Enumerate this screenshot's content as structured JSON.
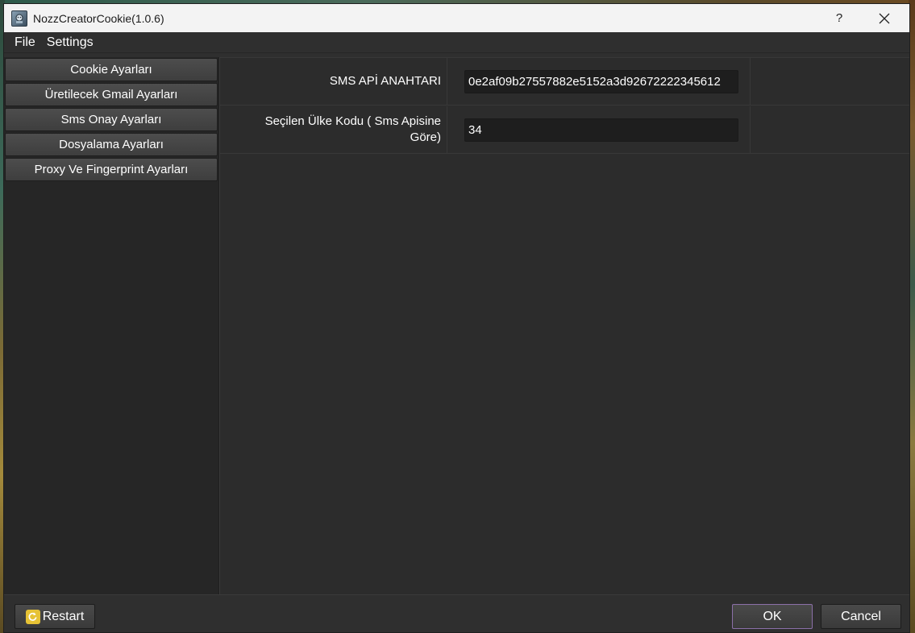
{
  "window": {
    "title": "NozzCreatorCookie(1.0.6)",
    "help_label": "?"
  },
  "menu": {
    "items": [
      {
        "label": "File"
      },
      {
        "label": "Settings"
      }
    ]
  },
  "sidebar": {
    "items": [
      {
        "label": "Cookie Ayarları"
      },
      {
        "label": "Üretilecek Gmail Ayarları"
      },
      {
        "label": "Sms Onay Ayarları"
      },
      {
        "label": "Dosyalama Ayarları"
      },
      {
        "label": "Proxy Ve Fingerprint Ayarları"
      }
    ]
  },
  "settings": {
    "rows": [
      {
        "label": "SMS APİ ANAHTARI",
        "value": "0e2af09b27557882e5152a3d92672222345612"
      },
      {
        "label_line1": "Seçilen Ülke Kodu ( Sms Apisine",
        "label_line2": "Göre)",
        "value": "34"
      }
    ]
  },
  "footer": {
    "restart_label": "Restart",
    "ok_label": "OK",
    "cancel_label": "Cancel"
  },
  "colors": {
    "window_bg": "#2f2f2f",
    "titlebar_bg": "#f3f3f3",
    "ok_border": "#8b6fa8",
    "restart_icon": "#e6c235"
  }
}
